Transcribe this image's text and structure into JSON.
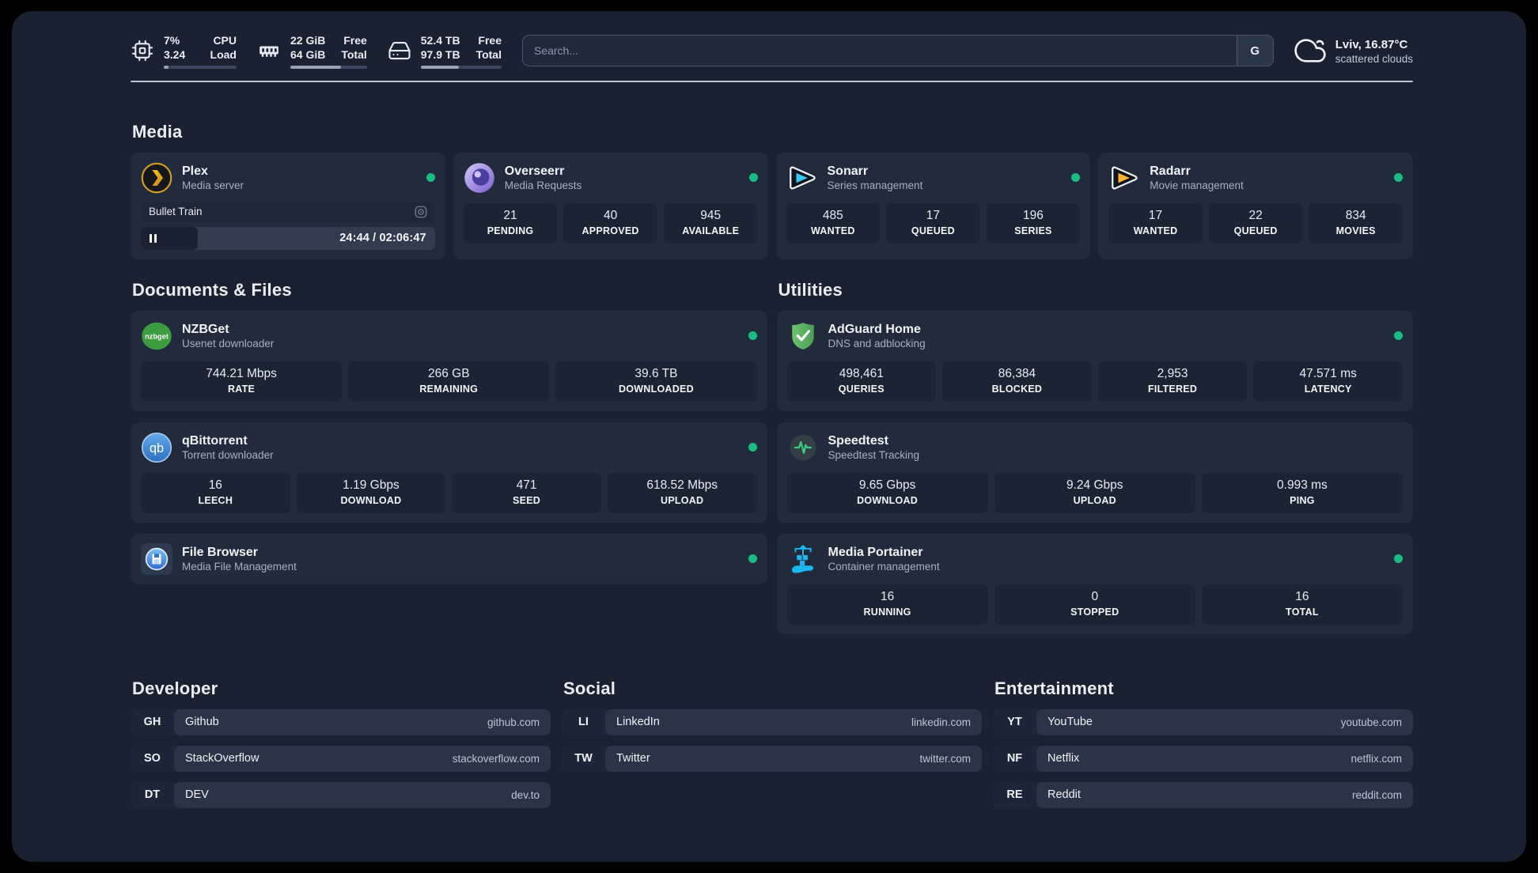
{
  "colors": {
    "page_bg": "#1a2232",
    "card_bg": "#222b3c",
    "status_dot_green": "#1abc84",
    "plex_amber": "#f5bd16",
    "sonarr_cyan": "#38c6f4",
    "radarr_yellow": "#ffb52e",
    "nzbget_green": "#3d9c40",
    "qbittorrent_blue": "#3e7fc2",
    "adguard_green": "#5db85c",
    "speedtest_green": "#35d07c",
    "portainer_blue": "#1db7f0",
    "filebrowser_blue": "#2f6fd0"
  },
  "topbar": {
    "resources": [
      {
        "icon": "cpu-icon",
        "values": [
          "7%",
          "3.24"
        ],
        "labels": [
          "CPU",
          "Load"
        ],
        "progress_pct": 7
      },
      {
        "icon": "memory-icon",
        "values": [
          "22 GiB",
          "64 GiB"
        ],
        "labels": [
          "Free",
          "Total"
        ],
        "progress_pct": 66
      },
      {
        "icon": "disk-icon",
        "values": [
          "52.4 TB",
          "97.9 TB"
        ],
        "labels": [
          "Free",
          "Total"
        ],
        "progress_pct": 47
      }
    ],
    "search": {
      "placeholder": "Search...",
      "button_label": "G"
    },
    "weather": {
      "icon": "scattered-clouds-icon",
      "location": "Lviv, 16.87°C",
      "condition": "scattered clouds"
    }
  },
  "sections": {
    "media": "Media",
    "documents": "Documents & Files",
    "utilities": "Utilities",
    "developer": "Developer",
    "social": "Social",
    "entertainment": "Entertainment"
  },
  "services": {
    "plex": {
      "title": "Plex",
      "subtitle": "Media server",
      "now_playing": {
        "title": "Bullet Train",
        "time": "24:44 / 02:06:47",
        "progress_pct": 19.5,
        "state": "paused"
      }
    },
    "overseerr": {
      "title": "Overseerr",
      "subtitle": "Media Requests",
      "stats": [
        {
          "value": "21",
          "label": "PENDING"
        },
        {
          "value": "40",
          "label": "APPROVED"
        },
        {
          "value": "945",
          "label": "AVAILABLE"
        }
      ]
    },
    "sonarr": {
      "title": "Sonarr",
      "subtitle": "Series management",
      "stats": [
        {
          "value": "485",
          "label": "WANTED"
        },
        {
          "value": "17",
          "label": "QUEUED"
        },
        {
          "value": "196",
          "label": "SERIES"
        }
      ]
    },
    "radarr": {
      "title": "Radarr",
      "subtitle": "Movie management",
      "stats": [
        {
          "value": "17",
          "label": "WANTED"
        },
        {
          "value": "22",
          "label": "QUEUED"
        },
        {
          "value": "834",
          "label": "MOVIES"
        }
      ]
    },
    "nzbget": {
      "title": "NZBGet",
      "subtitle": "Usenet downloader",
      "stats": [
        {
          "value": "744.21 Mbps",
          "label": "RATE"
        },
        {
          "value": "266 GB",
          "label": "REMAINING"
        },
        {
          "value": "39.6 TB",
          "label": "DOWNLOADED"
        }
      ]
    },
    "qbittorrent": {
      "title": "qBittorrent",
      "subtitle": "Torrent downloader",
      "stats": [
        {
          "value": "16",
          "label": "LEECH"
        },
        {
          "value": "1.19 Gbps",
          "label": "DOWNLOAD"
        },
        {
          "value": "471",
          "label": "SEED"
        },
        {
          "value": "618.52 Mbps",
          "label": "UPLOAD"
        }
      ]
    },
    "filebrowser": {
      "title": "File Browser",
      "subtitle": "Media File Management"
    },
    "adguard": {
      "title": "AdGuard Home",
      "subtitle": "DNS and adblocking",
      "stats": [
        {
          "value": "498,461",
          "label": "QUERIES"
        },
        {
          "value": "86,384",
          "label": "BLOCKED"
        },
        {
          "value": "2,953",
          "label": "FILTERED"
        },
        {
          "value": "47.571 ms",
          "label": "LATENCY"
        }
      ]
    },
    "speedtest": {
      "title": "Speedtest",
      "subtitle": "Speedtest Tracking",
      "stats": [
        {
          "value": "9.65 Gbps",
          "label": "DOWNLOAD"
        },
        {
          "value": "9.24 Gbps",
          "label": "UPLOAD"
        },
        {
          "value": "0.993 ms",
          "label": "PING"
        }
      ]
    },
    "portainer": {
      "title": "Media Portainer",
      "subtitle": "Container management",
      "stats": [
        {
          "value": "16",
          "label": "RUNNING"
        },
        {
          "value": "0",
          "label": "STOPPED"
        },
        {
          "value": "16",
          "label": "TOTAL"
        }
      ]
    }
  },
  "bookmarks": {
    "developer": [
      {
        "abbr": "GH",
        "name": "Github",
        "url": "github.com"
      },
      {
        "abbr": "SO",
        "name": "StackOverflow",
        "url": "stackoverflow.com"
      },
      {
        "abbr": "DT",
        "name": "DEV",
        "url": "dev.to"
      }
    ],
    "social": [
      {
        "abbr": "LI",
        "name": "LinkedIn",
        "url": "linkedin.com"
      },
      {
        "abbr": "TW",
        "name": "Twitter",
        "url": "twitter.com"
      }
    ],
    "entertainment": [
      {
        "abbr": "YT",
        "name": "YouTube",
        "url": "youtube.com"
      },
      {
        "abbr": "NF",
        "name": "Netflix",
        "url": "netflix.com"
      },
      {
        "abbr": "RE",
        "name": "Reddit",
        "url": "reddit.com"
      }
    ]
  }
}
